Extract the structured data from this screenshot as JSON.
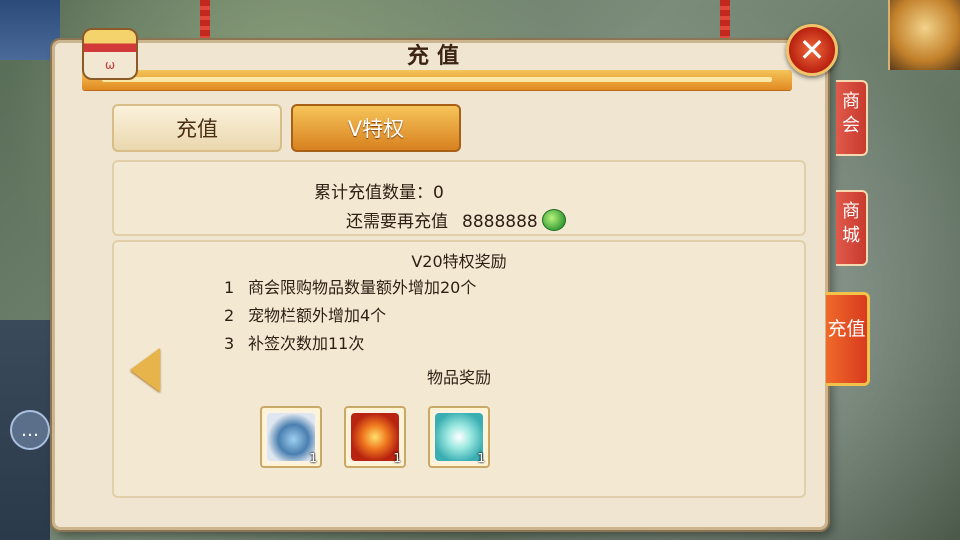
{
  "window": {
    "title": "充值"
  },
  "tabs": [
    {
      "label": "充值",
      "active": false
    },
    {
      "label": "V特权",
      "active": true
    }
  ],
  "summary": {
    "total_label": "累计充值数量：",
    "total_value": "0",
    "need_label": "还需要再充值",
    "need_value": "8888888",
    "currency_icon": "green-jade-coin-icon"
  },
  "privileges": {
    "title": "V20特权奖励",
    "items": [
      {
        "num": "1",
        "text": "商会限购物品数量额外增加20个"
      },
      {
        "num": "2",
        "text": "宠物栏额外增加4个"
      },
      {
        "num": "3",
        "text": "补签次数加11次"
      }
    ]
  },
  "rewards": {
    "title": "物品奖励",
    "items": [
      {
        "icon": "blue-orb-necklace-icon",
        "count": "1"
      },
      {
        "icon": "flame-phoenix-item-icon",
        "count": "1"
      },
      {
        "icon": "jade-bracelet-icon",
        "count": "1"
      }
    ]
  },
  "side_tabs": [
    {
      "label": "商会"
    },
    {
      "label": "商城"
    },
    {
      "label": "充值"
    }
  ],
  "colors": {
    "panel_bg": "#efe5d1",
    "accent_orange": "#e08a20",
    "side_tab_red": "#c83a2e"
  }
}
